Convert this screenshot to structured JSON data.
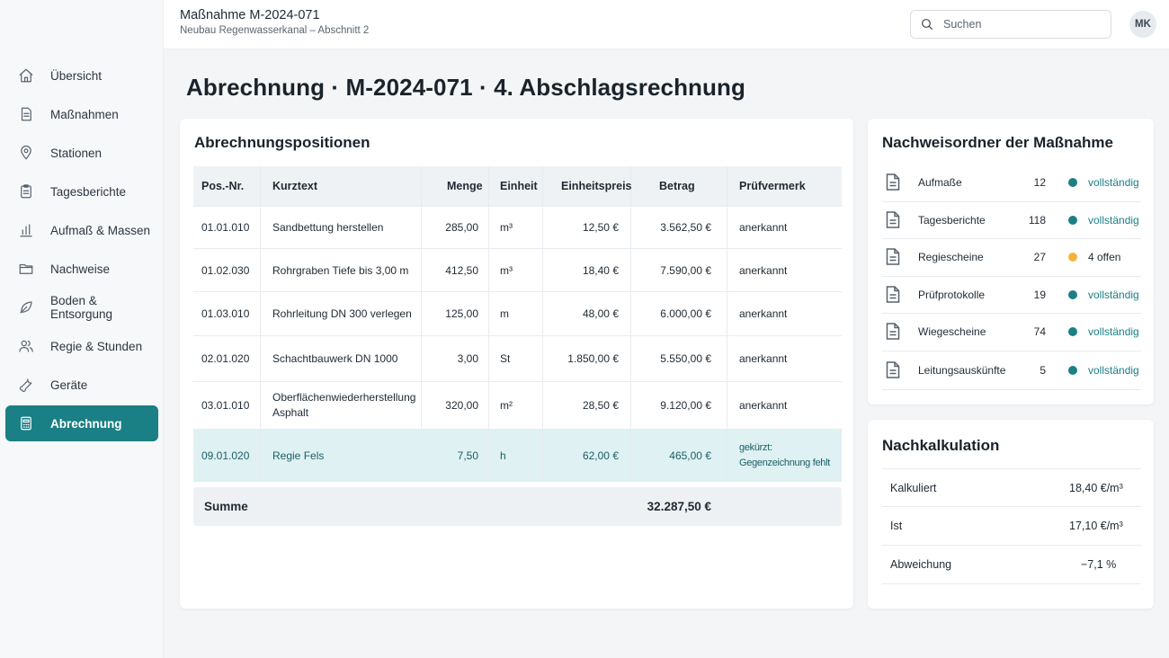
{
  "header": {
    "title": "Maßnahme M-2024-071",
    "subtitle": "Neubau Regenwasserkanal – Abschnitt 2",
    "search_placeholder": "Suchen",
    "avatar_initials": "MK"
  },
  "sidebar": {
    "items": [
      {
        "label": "Übersicht",
        "icon": "home-icon"
      },
      {
        "label": "Maßnahmen",
        "icon": "document-icon"
      },
      {
        "label": "Stationen",
        "icon": "map-pin-icon"
      },
      {
        "label": "Tagesberichte",
        "icon": "clipboard-icon"
      },
      {
        "label": "Aufmaß & Massen",
        "icon": "bar-chart-icon"
      },
      {
        "label": "Nachweise",
        "icon": "folder-icon"
      },
      {
        "label": "Boden & Entsorgung",
        "icon": "leaf-icon"
      },
      {
        "label": "Regie & Stunden",
        "icon": "users-icon"
      },
      {
        "label": "Geräte",
        "icon": "wrench-icon"
      },
      {
        "label": "Abrechnung",
        "icon": "calculator-icon",
        "active": true
      }
    ]
  },
  "page": {
    "title": "Abrechnung · M-2024-071 · 4. Abschlagsrechnung"
  },
  "positions": {
    "title": "Abrechnungspositionen",
    "columns": [
      "Pos.-Nr.",
      "Kurztext",
      "Menge",
      "Einheit",
      "Einheitspreis",
      "Betrag",
      "Prüfvermerk"
    ],
    "rows": [
      {
        "pos": "01.01.010",
        "text": "Sandbettung herstellen",
        "menge": "285,00",
        "einheit": "m³",
        "ep": "12,50 €",
        "betrag": "3.562,50 €",
        "vermerk": "anerkannt"
      },
      {
        "pos": "01.02.030",
        "text": "Rohrgraben Tiefe bis 3,00 m",
        "menge": "412,50",
        "einheit": "m³",
        "ep": "18,40 €",
        "betrag": "7.590,00 €",
        "vermerk": "anerkannt"
      },
      {
        "pos": "01.03.010",
        "text": "Rohrleitung DN 300 verlegen",
        "menge": "125,00",
        "einheit": "m",
        "ep": "48,00 €",
        "betrag": "6.000,00 €",
        "vermerk": "anerkannt"
      },
      {
        "pos": "02.01.020",
        "text": "Schachtbauwerk DN 1000",
        "menge": "3,00",
        "einheit": "St",
        "ep": "1.850,00 €",
        "betrag": "5.550,00 €",
        "vermerk": "anerkannt"
      },
      {
        "pos": "03.01.010",
        "text": "Oberflächenwiederherstellung Asphalt",
        "menge": "320,00",
        "einheit": "m²",
        "ep": "28,50 €",
        "betrag": "9.120,00 €",
        "vermerk": "anerkannt"
      },
      {
        "pos": "09.01.020",
        "text": "Regie Fels",
        "menge": "7,50",
        "einheit": "h",
        "ep": "62,00 €",
        "betrag": "465,00 €",
        "vermerk": "gekürzt: Gegenzeichnung fehlt",
        "highlight": true
      }
    ],
    "sum_label": "Summe",
    "sum_value": "32.287,50 €"
  },
  "nachweise": {
    "title": "Nachweisordner der Maßnahme",
    "items": [
      {
        "name": "Aufmaße",
        "count": "12",
        "status": "vollständig",
        "status_color": "#1b7f86"
      },
      {
        "name": "Tagesberichte",
        "count": "118",
        "status": "vollständig",
        "status_color": "#1b7f86"
      },
      {
        "name": "Regiescheine",
        "count": "27",
        "status": "4 offen",
        "status_color": "#f2b33d"
      },
      {
        "name": "Prüfprotokolle",
        "count": "19",
        "status": "vollständig",
        "status_color": "#1b7f86"
      },
      {
        "name": "Wiegescheine",
        "count": "74",
        "status": "vollständig",
        "status_color": "#1b7f86"
      },
      {
        "name": "Leitungsauskünfte",
        "count": "5",
        "status": "vollständig",
        "status_color": "#1b7f86"
      }
    ]
  },
  "nachkalkulation": {
    "title": "Nachkalkulation",
    "rows": [
      {
        "label": "Kalkuliert",
        "value": "18,40 €/m³"
      },
      {
        "label": "Ist",
        "value": "17,10 €/m³"
      },
      {
        "label": "Abweichung",
        "value": "−7,1 %"
      }
    ]
  },
  "colors": {
    "accent": "#1b7f86",
    "warning": "#f2b33d",
    "highlight_row": "#dff1f3"
  }
}
